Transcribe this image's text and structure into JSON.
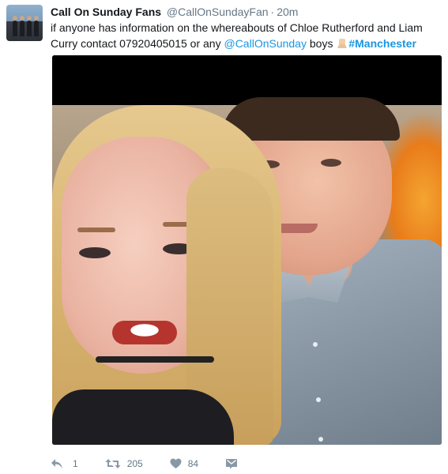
{
  "tweet": {
    "display_name": "Call On Sunday Fans",
    "handle": "@CallOnSundayFan",
    "separator": "·",
    "time": "20m",
    "text_part1": "if anyone has information on the whereabouts of Chloe Rutherford and Liam Curry contact 07920405015 or any ",
    "mention": "@CallOnSunday",
    "text_part2": " boys ",
    "hashtag": "#Manchester",
    "emoji_icon": "folded-hands-emoji"
  },
  "actions": {
    "reply_count": "1",
    "retweet_count": "205",
    "like_count": "84"
  },
  "colors": {
    "link": "#1b95e0",
    "muted": "#657786",
    "text": "#14171a"
  }
}
